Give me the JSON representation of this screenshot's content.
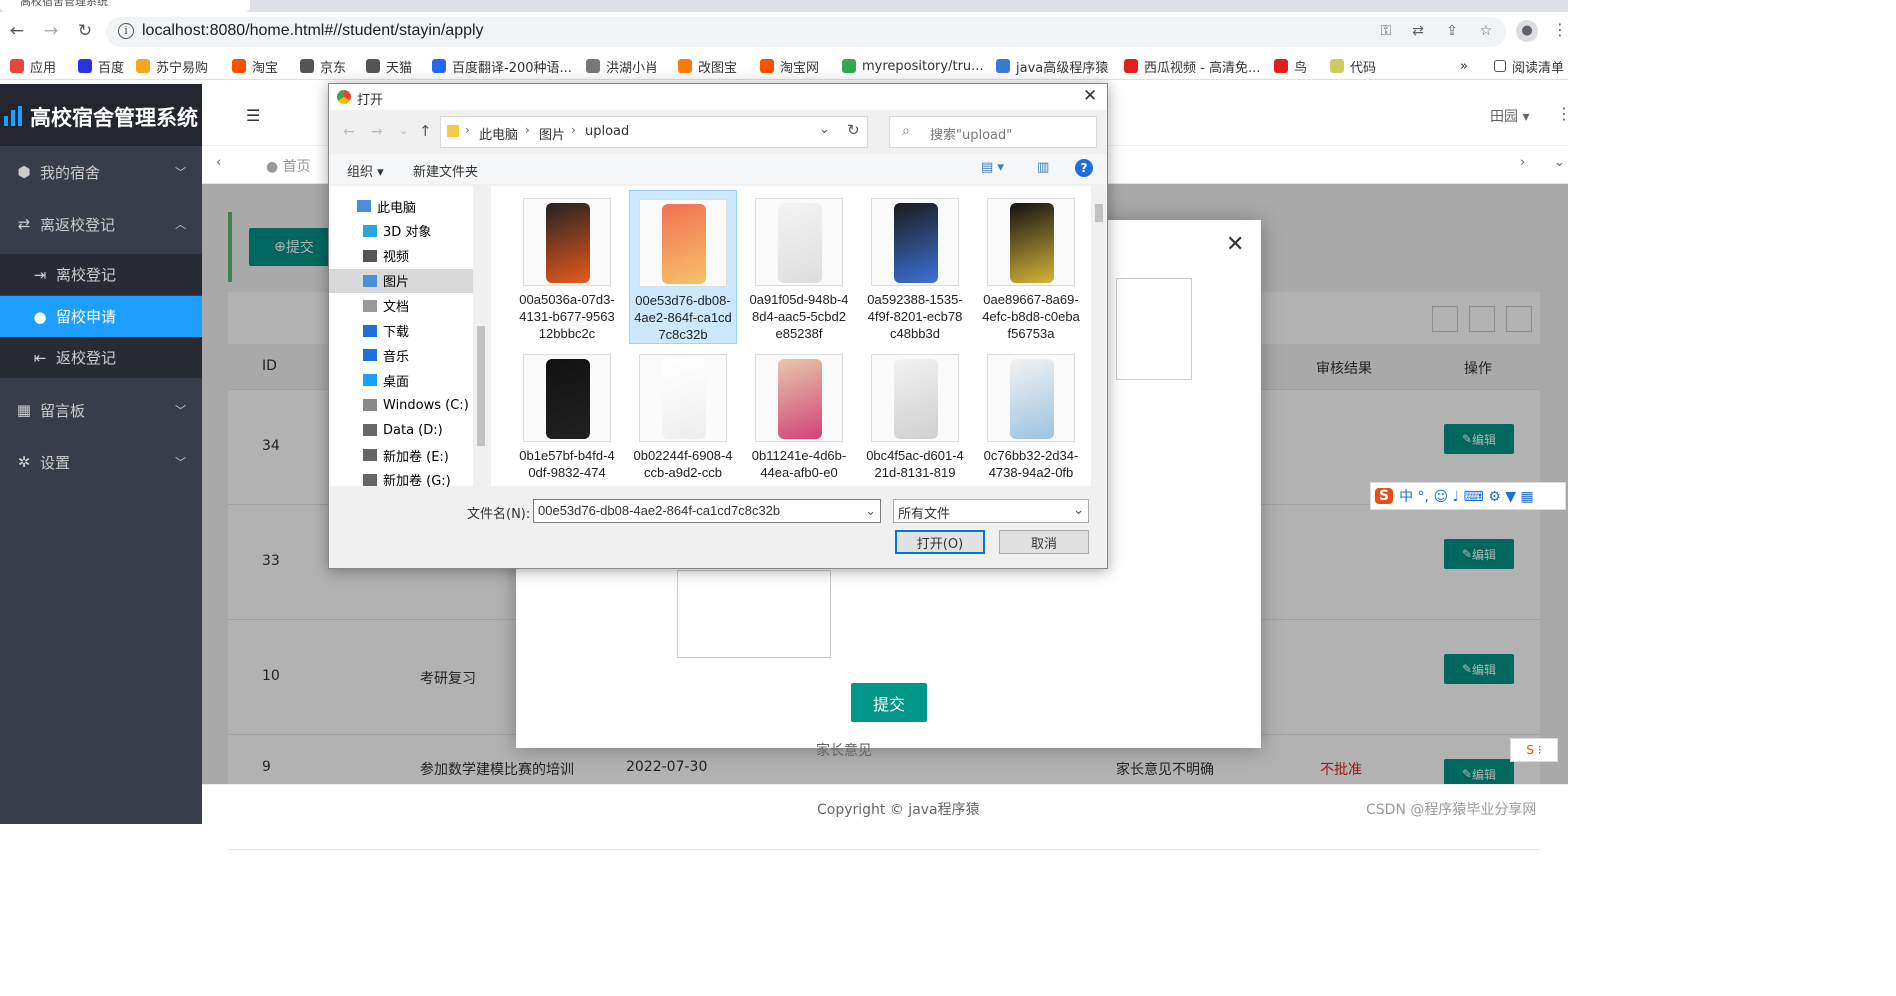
{
  "browser": {
    "tab_title": "高校宿舍管理系统",
    "url": "localhost:8080/home.html#//student/stayin/apply",
    "bookmarks": [
      "应用",
      "百度",
      "苏宁易购",
      "淘宝",
      "京东",
      "天猫",
      "百度翻译-200种语...",
      "洪湖小肖",
      "改图宝",
      "淘宝网",
      "myrepository/tru...",
      "java高级程序猿",
      "西瓜视频 - 高清免...",
      "鸟",
      "代码"
    ],
    "bookmarks_more": "»",
    "reading_list": "阅读清单",
    "bookmark_colors": [
      "#e8453c",
      "#2932e1",
      "#f5a623",
      "#ff5000",
      "#555555",
      "#555555",
      "#2468f2",
      "#777777",
      "#ff7b00",
      "#ff5000",
      "#34a853",
      "#3a7bd5",
      "#e02020",
      "#e02020",
      "#cccc66"
    ]
  },
  "app": {
    "title": "高校宿舍管理系统",
    "menu": [
      {
        "label": "我的宿舍",
        "icon": "cube-icon"
      },
      {
        "label": "离返校登记",
        "icon": "swap-icon"
      },
      {
        "label": "留言板",
        "icon": "calendar-icon"
      },
      {
        "label": "设置",
        "icon": "gear-icon"
      }
    ],
    "submenu": [
      "离校登记",
      "留校申请",
      "返校登记"
    ],
    "topbar_right": "田园",
    "home_tab": "首页",
    "submit_label": "提交",
    "table_headers": {
      "id": "ID",
      "audit": "审核结果",
      "action": "操作"
    },
    "rows": [
      {
        "id": "34",
        "reason": "",
        "date": "",
        "opinion": "",
        "result": ""
      },
      {
        "id": "33",
        "reason": "",
        "date": "",
        "opinion": "",
        "result": ""
      },
      {
        "id": "10",
        "reason": "考研复习",
        "date": "",
        "opinion": "",
        "result": ""
      },
      {
        "id": "9",
        "reason": "参加数学建模比赛的培训",
        "date": "2022-07-30",
        "opinion": "家长意见不明确",
        "result": "不批准"
      }
    ],
    "edit_label": "编辑",
    "footer": "Copyright © java程序猿",
    "watermark": "CSDN @程序猿毕业分享网",
    "modal": {
      "submit": "提交",
      "parent_opinion_label": "家长意见"
    }
  },
  "dialog": {
    "title": "打开",
    "path": [
      "此电脑",
      "图片",
      "upload"
    ],
    "search_placeholder": "搜索\"upload\"",
    "organize": "组织 ▾",
    "new_folder": "新建文件夹",
    "tree": [
      "此电脑",
      "3D 对象",
      "视频",
      "图片",
      "文档",
      "下载",
      "音乐",
      "桌面",
      "Windows (C:)",
      "Data (D:)",
      "新加卷 (E:)",
      "新加卷 (G:)"
    ],
    "files": [
      "00a5036a-07d3-4131-b677-956312bbbc2c",
      "00e53d76-db08-4ae2-864f-ca1cd7c8c32b",
      "0a91f05d-948b-48d4-aac5-5cbd2e85238f",
      "0a592388-1535-4f9f-8201-ecb78c48bb3d",
      "0ae89667-8a69-4efc-b8d8-c0ebaf56753a",
      "0b1e57bf-b4fd-40df-9832-474",
      "0b02244f-6908-4ccb-a9d2-ccb",
      "0b11241e-4d6b-44ea-afb0-e0",
      "0bc4f5ac-d601-421d-8131-819",
      "0c76bb32-2d34-4738-94a2-0fb"
    ],
    "filename_label": "文件名(N):",
    "filename_value": "00e53d76-db08-4ae2-864f-ca1cd7c8c32b",
    "filetype": "所有文件",
    "open_button": "打开(O)",
    "cancel_button": "取消"
  }
}
